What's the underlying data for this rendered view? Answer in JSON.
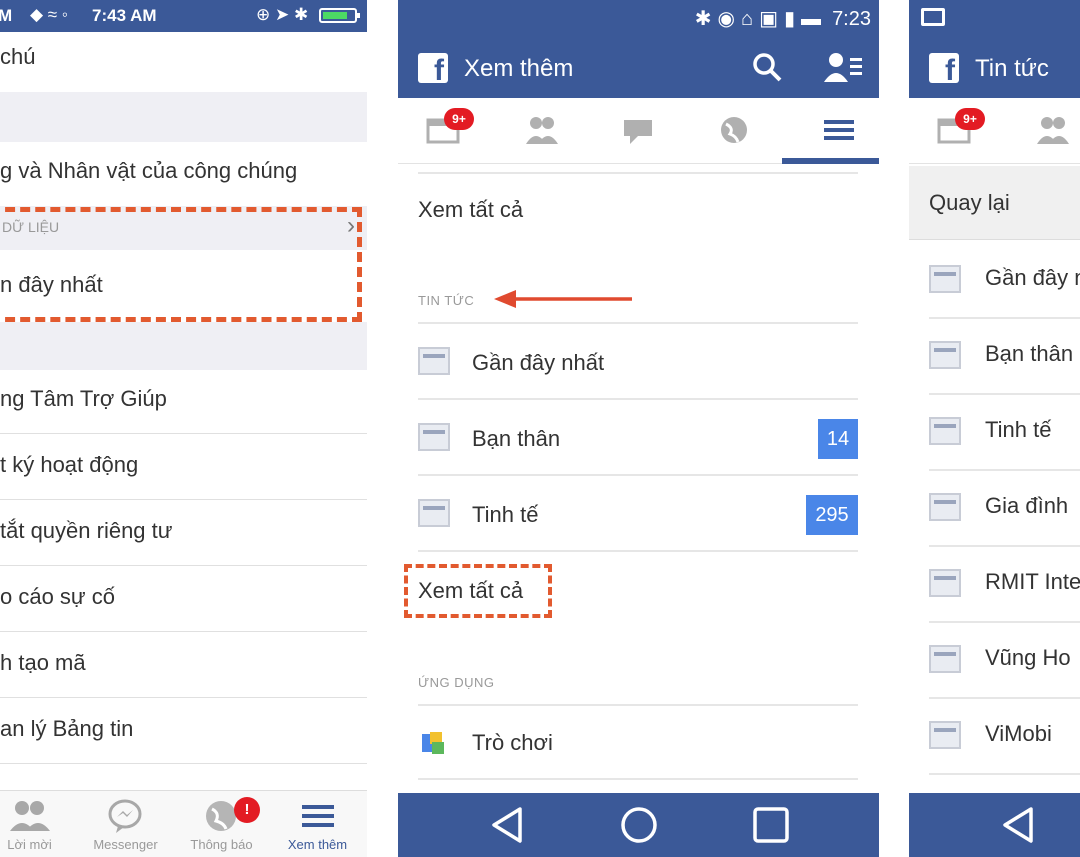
{
  "panel_left": {
    "status": {
      "carrier": "M",
      "time": "7:43 AM"
    },
    "items": [
      {
        "label": "chú"
      },
      {
        "label": "g và Nhân vật của công chúng"
      },
      {
        "section": "DỮ LIỆU"
      },
      {
        "label": "n đây nhất"
      },
      {
        "label": "ng Tâm Trợ Giúp"
      },
      {
        "label": "t ký hoạt động"
      },
      {
        "label": "tắt quyền riêng tư"
      },
      {
        "label": "o cáo sự cố"
      },
      {
        "label": "h tạo mã"
      },
      {
        "label": "an lý Bảng tin"
      }
    ],
    "tabbar": [
      {
        "label": "Lời mời",
        "icon": "friends-icon"
      },
      {
        "label": "Messenger",
        "icon": "messenger-icon"
      },
      {
        "label": "Thông báo",
        "icon": "globe-icon",
        "badge": "!"
      },
      {
        "label": "Xem thêm",
        "icon": "menu-icon",
        "active": true
      }
    ]
  },
  "panel_middle": {
    "status": {
      "time": "7:23"
    },
    "title": "Xem thêm",
    "tabs": [
      {
        "icon": "news-feed-icon",
        "badge": "9+"
      },
      {
        "icon": "friends-icon"
      },
      {
        "icon": "chat-icon"
      },
      {
        "icon": "globe-icon"
      },
      {
        "icon": "menu-icon",
        "active": true
      }
    ],
    "see_all_top": "Xem tất cả",
    "news_section": "TIN TỨC",
    "feeds": [
      {
        "label": "Gần đây nhất"
      },
      {
        "label": "Bạn thân",
        "count": "14"
      },
      {
        "label": "Tinh tế",
        "count": "295"
      }
    ],
    "see_all": "Xem tất cả",
    "apps_section": "ỨNG DỤNG",
    "apps": [
      {
        "label": "Trò chơi"
      }
    ]
  },
  "panel_right": {
    "title": "Tin tức",
    "tabs": [
      {
        "icon": "news-feed-icon",
        "badge": "9+"
      },
      {
        "icon": "friends-icon"
      }
    ],
    "back": "Quay lại",
    "feeds": [
      {
        "label": "Gần đây n"
      },
      {
        "label": "Bạn thân"
      },
      {
        "label": "Tinh tế"
      },
      {
        "label": "Gia đình"
      },
      {
        "label": "RMIT Inte"
      },
      {
        "label": "Vũng Ho"
      },
      {
        "label": "ViMobi"
      }
    ]
  },
  "colors": {
    "facebook_blue": "#3b5998",
    "highlight_orange": "#e25a2f",
    "badge_red": "#e31b23",
    "count_blue": "#4a86e8"
  }
}
